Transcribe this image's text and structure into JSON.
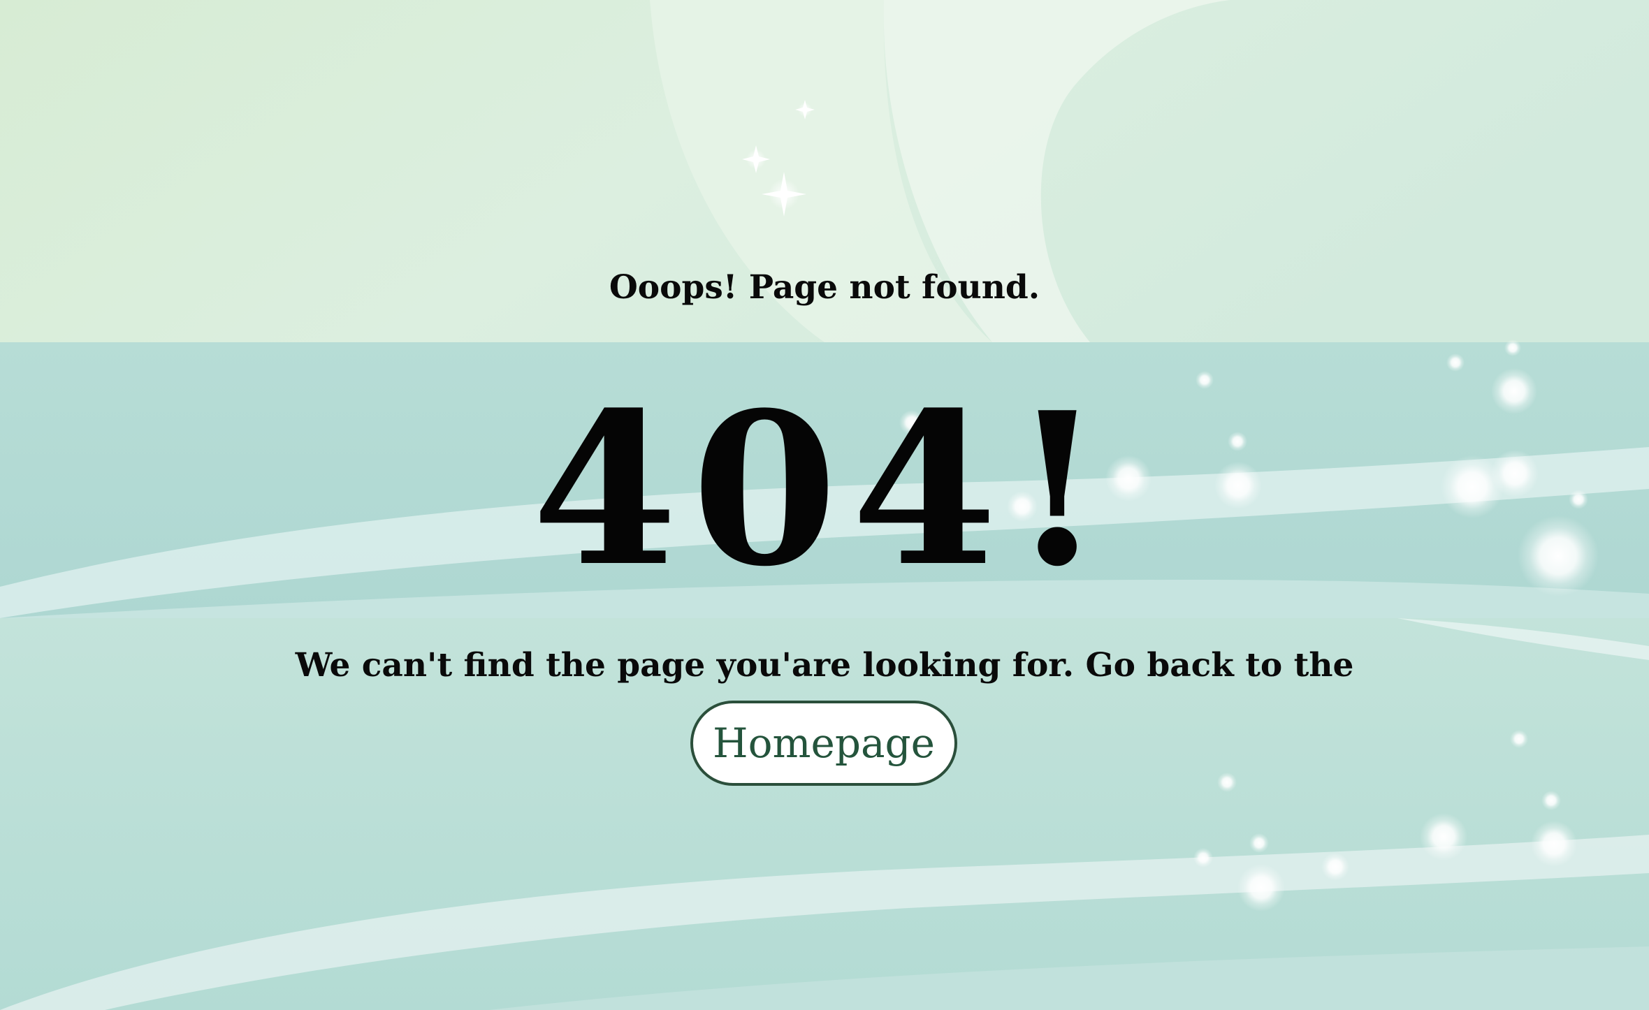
{
  "page": {
    "subtitle": "Ooops! Page not found.",
    "error_code": "404!",
    "message": "We can't find the page you'are looking for. Go back to the",
    "homepage_button": "Homepage"
  },
  "colors": {
    "background_top": "#dcefe0",
    "background_middle": "#b4ddd7",
    "background_bottom": "#bfe2da",
    "text": "#0a0a0a",
    "button_border": "#2b4f3b",
    "button_text": "#24543c",
    "button_background": "#ffffff"
  }
}
